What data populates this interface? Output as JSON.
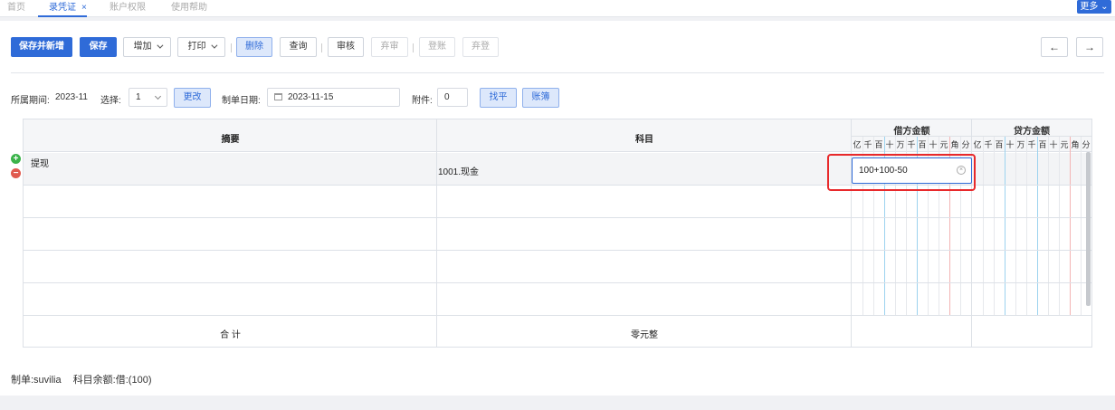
{
  "tabs": [
    {
      "label": "首页"
    },
    {
      "label": "录凭证",
      "close": "×"
    },
    {
      "label": "账户权限"
    },
    {
      "label": "使用帮助"
    }
  ],
  "more_button": "更多",
  "toolbar": {
    "save_new": "保存并新增",
    "save": "保存",
    "add": "增加",
    "print": "打印",
    "delete": "删除",
    "query": "查询",
    "audit": "审核",
    "unaudit": "弃审",
    "post": "登账",
    "unpost": "弃登",
    "prev": "←",
    "next": "→"
  },
  "info": {
    "period_label": "所属期间:",
    "period_value": "2023-11",
    "select_label": "选择:",
    "select_value": "1",
    "change_button": "更改",
    "date_label": "制单日期:",
    "date_value": "2023-11-15",
    "attach_label": "附件:",
    "attach_value": "0",
    "find_balance": "找平",
    "ledger": "账簿"
  },
  "table": {
    "col_summary": "摘要",
    "col_subject": "科目",
    "col_debit": "借方金额",
    "col_credit": "贷方金额",
    "digits": [
      "亿",
      "千",
      "百",
      "十",
      "万",
      "千",
      "百",
      "十",
      "元",
      "角",
      "分"
    ],
    "rows": [
      {
        "summary": "提现",
        "subject": "1001.现金",
        "debit_input": "100+100-50"
      }
    ],
    "total_label": "合 计",
    "total_words": "零元整"
  },
  "footer": {
    "maker": "制单:suvilia",
    "balance": "科目余额:借:(100)"
  },
  "colors": {
    "primary": "#2f6bd8",
    "highlight": "#e8292b",
    "add": "#3bb34a",
    "remove": "#e05a4f"
  }
}
